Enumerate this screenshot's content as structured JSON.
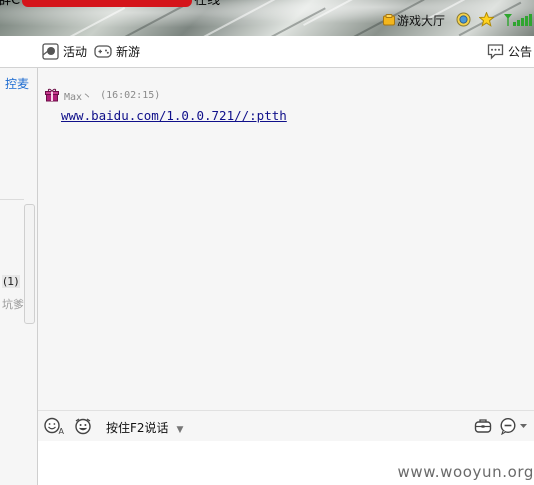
{
  "window": {
    "title_prefix": "群C",
    "title_suffix": "在线"
  },
  "banner": {
    "lobby_label": "游戏大厅",
    "icons": [
      "lobby-icon",
      "coin-icon",
      "star-icon",
      "signal-icon"
    ]
  },
  "toolbar": {
    "activity_label": "活动",
    "newgame_label": "新游",
    "notice_label": "公告"
  },
  "left_panel": {
    "mic_tab": "控麦",
    "count": "(1)",
    "tag": "坑爹"
  },
  "chat": {
    "messages": [
      {
        "nick": "Max丶",
        "time": "(16:02:15)",
        "text": "www.baidu.com/1.0.0.721//:ptth"
      }
    ]
  },
  "input_bar": {
    "push_to_talk_label": "按住F2说话",
    "caret": "▼"
  },
  "watermark": "www.wooyun.org",
  "colors": {
    "link": "#10108a",
    "mic_tab": "#1b6ad0",
    "redaction": "#d4141a",
    "signal": "#2fa52f"
  }
}
